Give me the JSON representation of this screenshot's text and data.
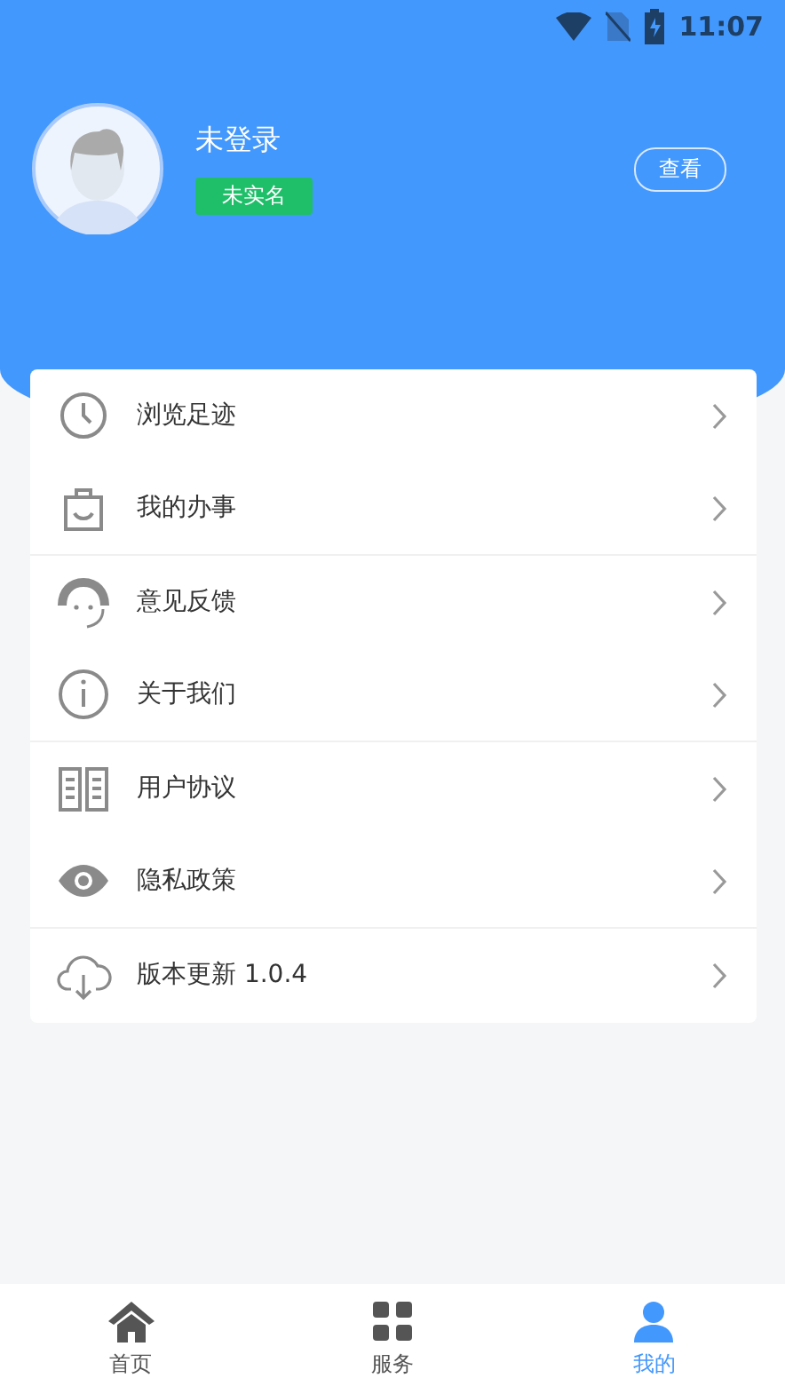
{
  "status_bar": {
    "time": "11:07"
  },
  "profile": {
    "name": "未登录",
    "badge": "未实名",
    "view_button": "查看"
  },
  "menu": [
    {
      "kind": "clock",
      "label": "浏览足迹"
    },
    {
      "kind": "bag",
      "label": "我的办事"
    },
    {
      "kind": "headset",
      "label": "意见反馈"
    },
    {
      "kind": "info",
      "label": "关于我们"
    },
    {
      "kind": "book",
      "label": "用户协议"
    },
    {
      "kind": "eye",
      "label": "隐私政策"
    },
    {
      "kind": "cloud",
      "label": "版本更新 1.0.4"
    }
  ],
  "tab_bar": [
    {
      "kind": "home",
      "label": "首页",
      "selected": false
    },
    {
      "kind": "service",
      "label": "服务",
      "selected": false
    },
    {
      "kind": "person",
      "label": "我的",
      "selected": true
    }
  ]
}
